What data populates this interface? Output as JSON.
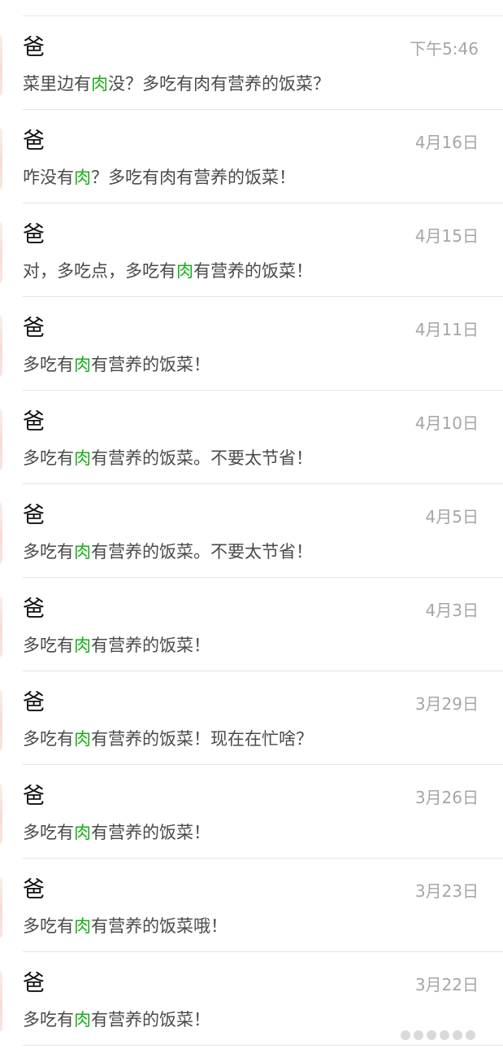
{
  "messages": [
    {
      "sender": "爸",
      "time": "下午5:46",
      "pre": "菜里边有",
      "keyword": "肉",
      "post": "没？多吃有肉有营养的饭菜？"
    },
    {
      "sender": "爸",
      "time": "4月16日",
      "pre": "咋没有",
      "keyword": "肉",
      "post": "？多吃有肉有营养的饭菜！"
    },
    {
      "sender": "爸",
      "time": "4月15日",
      "pre": "对，多吃点，多吃有",
      "keyword": "肉",
      "post": "有营养的饭菜！"
    },
    {
      "sender": "爸",
      "time": "4月11日",
      "pre": "多吃有",
      "keyword": "肉",
      "post": "有营养的饭菜！"
    },
    {
      "sender": "爸",
      "time": "4月10日",
      "pre": "多吃有",
      "keyword": "肉",
      "post": "有营养的饭菜。不要太节省！"
    },
    {
      "sender": "爸",
      "time": "4月5日",
      "pre": "多吃有",
      "keyword": "肉",
      "post": "有营养的饭菜。不要太节省！"
    },
    {
      "sender": "爸",
      "time": "4月3日",
      "pre": "多吃有",
      "keyword": "肉",
      "post": "有营养的饭菜！"
    },
    {
      "sender": "爸",
      "time": "3月29日",
      "pre": "多吃有",
      "keyword": "肉",
      "post": "有营养的饭菜！现在在忙啥？"
    },
    {
      "sender": "爸",
      "time": "3月26日",
      "pre": "多吃有",
      "keyword": "肉",
      "post": "有营养的饭菜！"
    },
    {
      "sender": "爸",
      "time": "3月23日",
      "pre": "多吃有",
      "keyword": "肉",
      "post": "有营养的饭菜哦！"
    },
    {
      "sender": "爸",
      "time": "3月22日",
      "pre": "多吃有",
      "keyword": "肉",
      "post": "有营养的饭菜！"
    }
  ],
  "colors": {
    "highlight": "#1aad19",
    "name": "#111111",
    "message": "#4a4a4a",
    "time": "#a6a6a6",
    "divider": "#e6e6e6"
  }
}
